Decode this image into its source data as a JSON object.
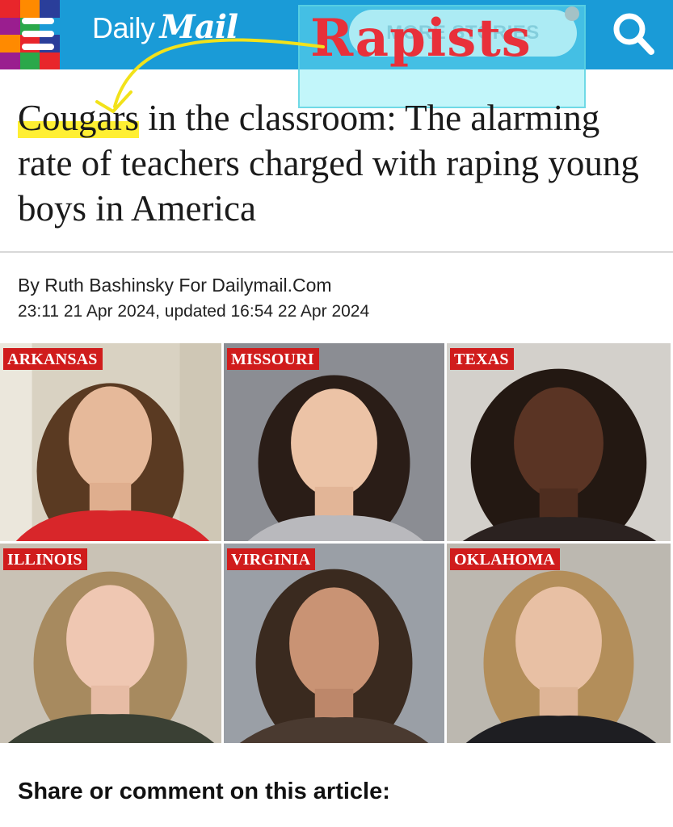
{
  "header": {
    "brand_first": "Daily",
    "brand_second": "Mail",
    "more_stories_label": "MORE STORIES",
    "menu_icon": "hamburger-menu-icon",
    "search_icon": "search-icon",
    "bar_color": "#1a9bd7",
    "logo_block_colors": [
      "#e8262b",
      "#ff8a00",
      "#2a3e9a",
      "#1a9bd7",
      "#9a1e8f",
      "#2aa84a",
      "#1a9bd7",
      "#1a9bd7",
      "#ff8a00",
      "#e8262b",
      "#2a3e9a",
      "#1a9bd7",
      "#9a1e8f",
      "#2aa84a",
      "#e8262b",
      "#1a9bd7"
    ]
  },
  "annotation": {
    "overlay_word": "Rapists",
    "overlay_color": "#e8303a",
    "highlight_color": "#ffee28",
    "arrow_color": "#f2e21a"
  },
  "article": {
    "headline_highlight": "Cougars",
    "headline_rest": " in the classroom: The alarming rate of teachers charged with raping young boys in America",
    "byline": "By Ruth Bashinsky For Dailymail.Com",
    "dateline": "23:11 21 Apr 2024, updated 16:54 22 Apr 2024"
  },
  "photos": [
    {
      "state": "ARKANSAS"
    },
    {
      "state": "MISSOURI"
    },
    {
      "state": "TEXAS"
    },
    {
      "state": "ILLINOIS"
    },
    {
      "state": "VIRGINIA"
    },
    {
      "state": "OKLAHOMA"
    }
  ],
  "share": {
    "label": "Share or comment on this article:"
  }
}
